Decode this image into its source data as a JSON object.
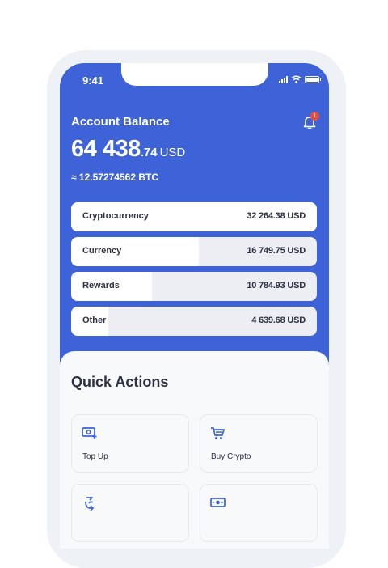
{
  "status_bar": {
    "time": "9:41"
  },
  "header": {
    "title": "Account Balance",
    "notification_count": "1",
    "balance_main": "64 438",
    "balance_cents": ".74",
    "balance_currency": "USD",
    "balance_btc": "≈ 12.57274562 BTC"
  },
  "allocations": [
    {
      "label": "Cryptocurrency",
      "value": "32 264.38 USD",
      "fill": 1.0
    },
    {
      "label": "Currency",
      "value": "16 749.75 USD",
      "fill": 0.52
    },
    {
      "label": "Rewards",
      "value": "10 784.93 USD",
      "fill": 0.33
    },
    {
      "label": "Other",
      "value": "4 639.68 USD",
      "fill": 0.15
    }
  ],
  "quick_actions": {
    "title": "Quick Actions",
    "items": [
      {
        "label": "Top Up",
        "icon": "money-plus-icon"
      },
      {
        "label": "Buy Crypto",
        "icon": "cart-icon"
      },
      {
        "label": "",
        "icon": "transfer-icon"
      },
      {
        "label": "",
        "icon": "cash-icon"
      }
    ]
  },
  "colors": {
    "primary": "#3e63d8",
    "badge": "#e74c3c",
    "text_dark": "#2d3142"
  }
}
